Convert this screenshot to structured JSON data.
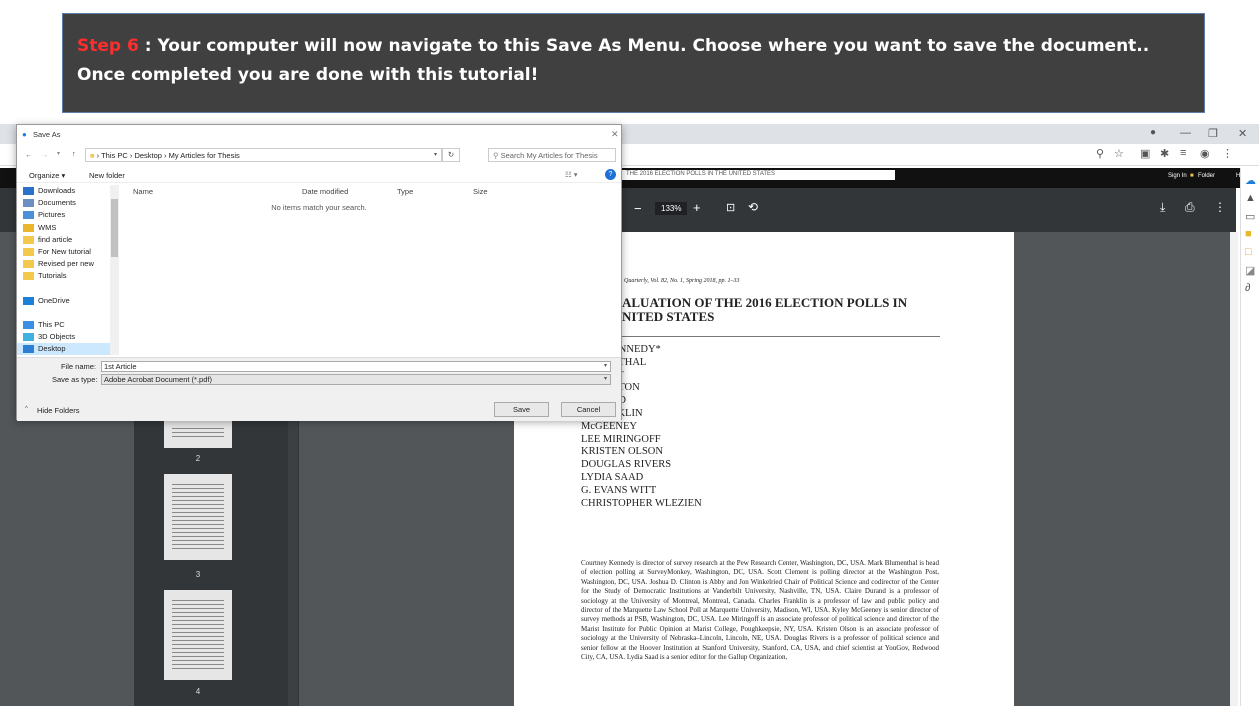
{
  "banner": {
    "step": "Step 6",
    "text": " : Your computer will now navigate to this Save As Menu.  Choose where you want to save the document.. Once completed you are done with this tutorial!"
  },
  "browser": {
    "appbar": {
      "signin": "Sign In",
      "folder": "Folder",
      "help": "Help"
    },
    "tab_strip_text": "THE 2016 ELECTION POLLS IN THE UNITED STATES",
    "zoom": "133%",
    "thumbnails": [
      "2",
      "3",
      "4"
    ]
  },
  "pdf": {
    "citation": "Quarterly, Vol. 82, No. 1, Spring 2018, pp. 1–33",
    "title_line1": "ALUATION OF THE 2016 ELECTION POLLS IN",
    "title_line2": "NITED STATES",
    "authors": [
      "NEY KENNEDY*",
      "LUMENTHAL",
      "LEMENT",
      "D. CLINTON",
      "DURAND",
      "S FRANKLIN",
      "McGEENEY",
      "LEE MIRINGOFF",
      "KRISTEN OLSON",
      "DOUGLAS RIVERS",
      "LYDIA SAAD",
      "G. EVANS WITT",
      "CHRISTOPHER WLEZIEN"
    ],
    "bio": "Courtney Kennedy is director of survey research at the Pew Research Center, Washington, DC, USA. Mark Blumenthal is head of election polling at SurveyMonkey, Washington, DC, USA. Scott Clement is polling director at the Washington Post, Washington, DC, USA. Joshua D. Clinton is Abby and Jon Winkelried Chair of Political Science and codirector of the Center for the Study of Democratic Institutions at Vanderbilt University, Nashville, TN, USA. Claire Durand is a professor of sociology at the University of Montreal, Montreal, Canada. Charles Franklin is a professor of law and public policy and director of the Marquette Law School Poll at Marquette University, Madison, WI, USA. Kyley McGeeney is senior director of survey methods at PSB, Washington, DC, USA. Lee Miringoff is an associate professor of political science and director of the Marist Institute for Public Opinion at Marist College, Poughkeepsie, NY, USA. Kristen Olson is an associate professor of sociology at the University of Nebraska–Lincoln, Lincoln, NE, USA. Douglas Rivers is a professor of political science and senior fellow at the Hoover Institution at Stanford University, Stanford, CA, USA, and chief scientist at YouGov, Redwood City, CA, USA. Lydia Saad is a senior editor for the Gallup Organization,"
  },
  "dialog": {
    "title": "Save As",
    "path": [
      "This PC",
      "Desktop",
      "My Articles for Thesis"
    ],
    "search_placeholder": "Search My Articles for Thesis",
    "organize": "Organize ▾",
    "new_folder": "New folder",
    "columns": [
      "Name",
      "Date modified",
      "Type",
      "Size"
    ],
    "empty_message": "No items match your search.",
    "tree": [
      {
        "label": "Downloads",
        "icon": "download-icon",
        "color": "#2a72c9"
      },
      {
        "label": "Documents",
        "icon": "document-icon",
        "color": "#6a8fc0"
      },
      {
        "label": "Pictures",
        "icon": "pictures-icon",
        "color": "#4b8fd6"
      },
      {
        "label": "WMS",
        "icon": "star-icon",
        "color": "#e8b72c"
      },
      {
        "label": "find article",
        "icon": "folder-icon",
        "color": "#f2c94c"
      },
      {
        "label": "For New tutorial",
        "icon": "folder-icon",
        "color": "#f2c94c"
      },
      {
        "label": "Revised per new",
        "icon": "folder-icon",
        "color": "#f2c94c"
      },
      {
        "label": "Tutorials",
        "icon": "folder-icon",
        "color": "#f2c94c"
      },
      {
        "label": "",
        "icon": "spacer",
        "color": "#fff"
      },
      {
        "label": "OneDrive",
        "icon": "cloud-icon",
        "color": "#1e7fd8"
      },
      {
        "label": "",
        "icon": "spacer",
        "color": "#fff"
      },
      {
        "label": "This PC",
        "icon": "pc-icon",
        "color": "#3a8ee6"
      },
      {
        "label": "3D Objects",
        "icon": "cube-icon",
        "color": "#3fb0e0"
      },
      {
        "label": "Desktop",
        "icon": "desktop-icon",
        "color": "#2d7fd3"
      }
    ],
    "file_name_label": "File name:",
    "file_name_value": "1st Article",
    "save_type_label": "Save as type:",
    "save_type_value": "Adobe Acrobat Document (*.pdf)",
    "hide_folders": "Hide Folders",
    "save": "Save",
    "cancel": "Cancel"
  }
}
